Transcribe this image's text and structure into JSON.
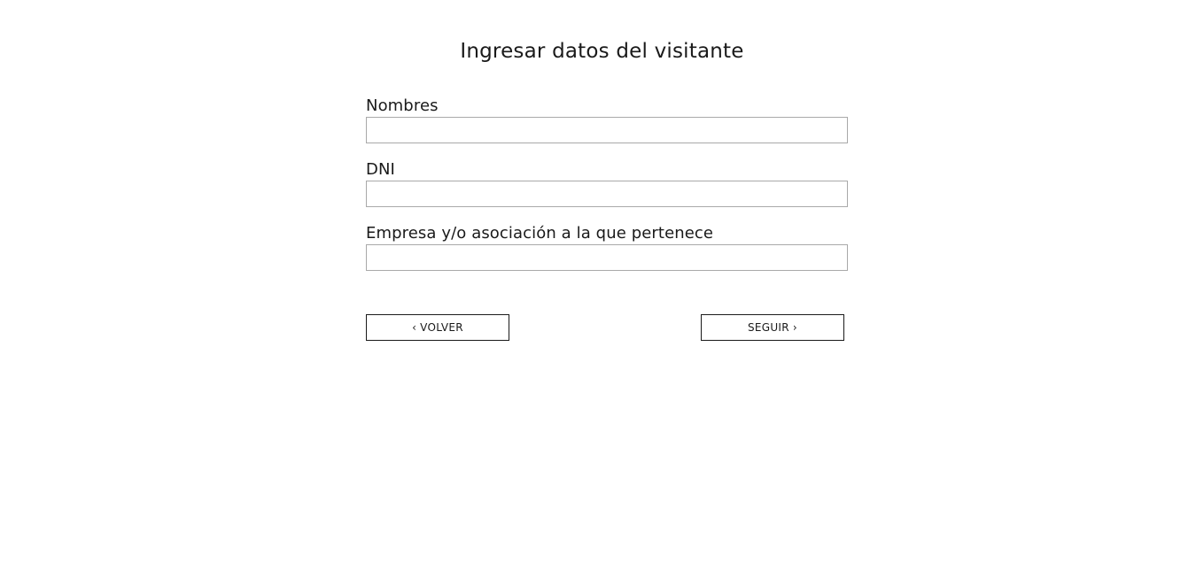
{
  "page": {
    "title": "Ingresar datos del visitante"
  },
  "form": {
    "fields": [
      {
        "label": "Nombres",
        "value": "",
        "placeholder": ""
      },
      {
        "label": "DNI",
        "value": "",
        "placeholder": ""
      },
      {
        "label": "Empresa y/o asociación a la que pertenece",
        "value": "",
        "placeholder": ""
      }
    ]
  },
  "actions": {
    "back_label": "VOLVER",
    "back_icon": "‹",
    "next_label": "SEGUIR",
    "next_icon": "›"
  }
}
